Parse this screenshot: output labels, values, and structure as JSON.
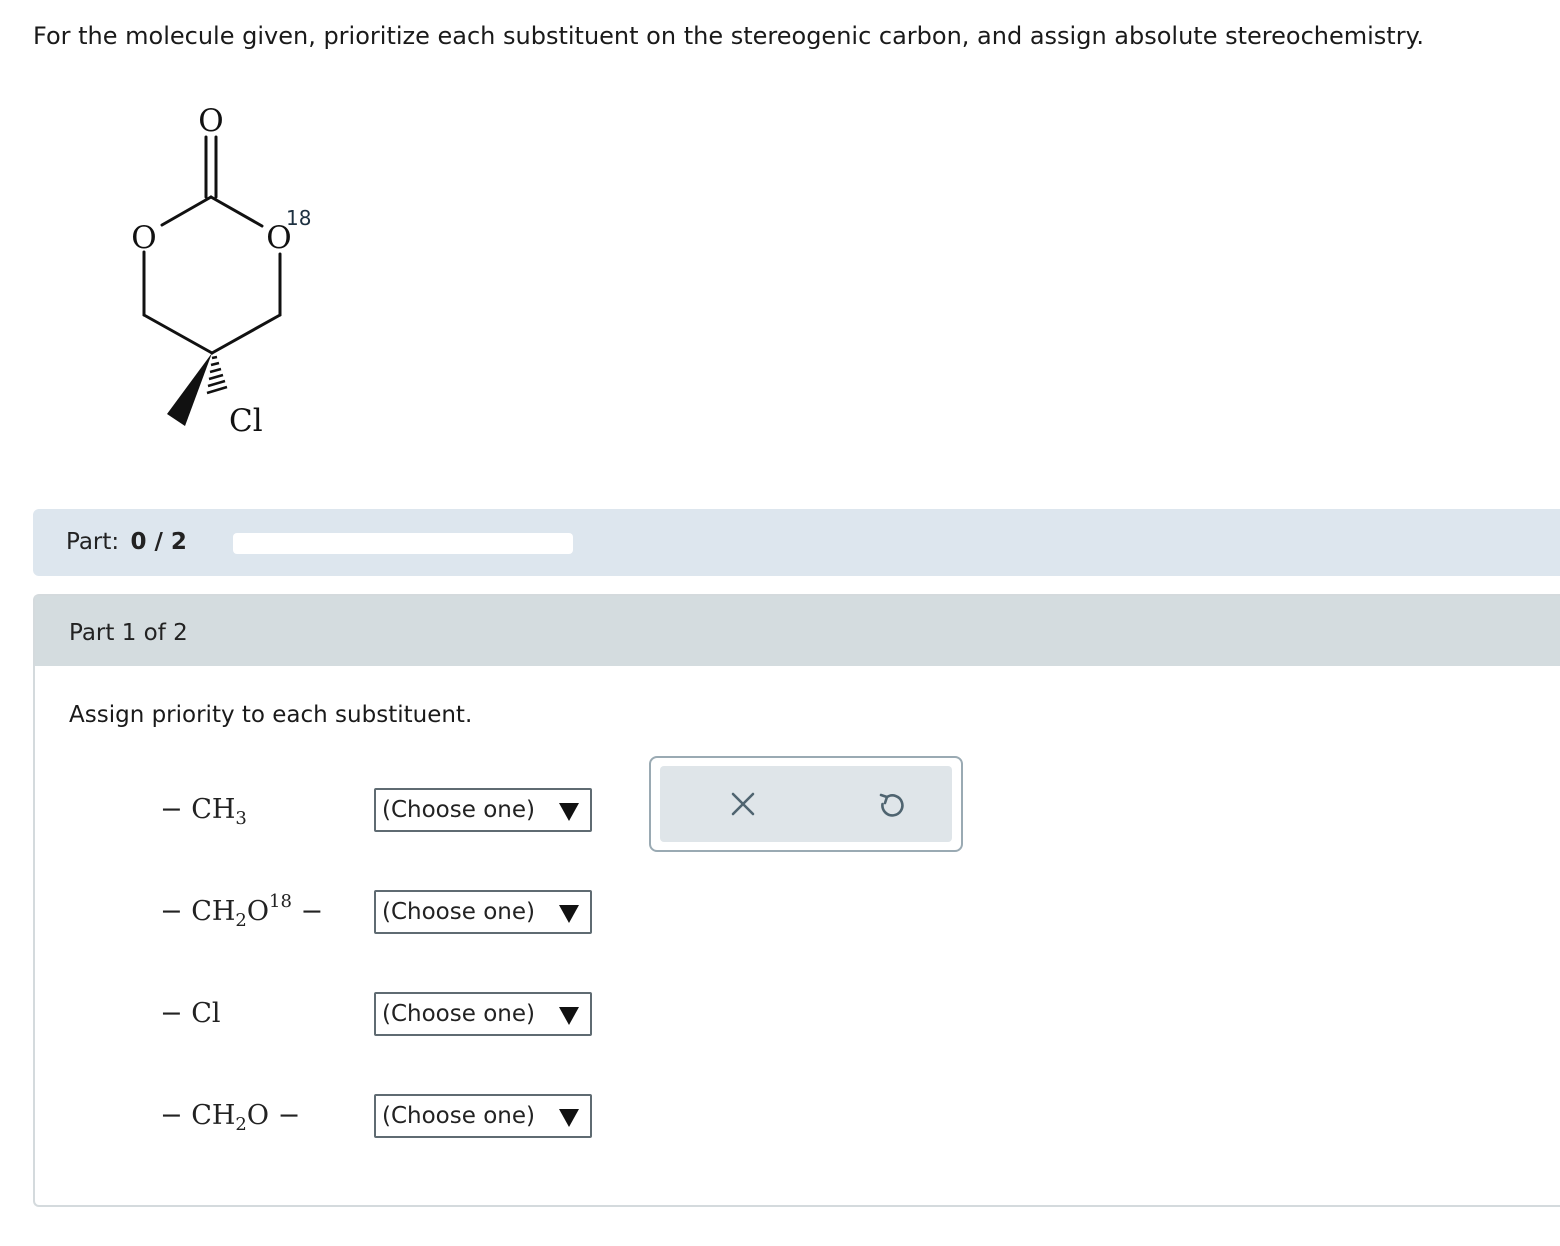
{
  "question": "For the molecule given, prioritize each substituent on the stereogenic carbon, and assign absolute stereochemistry.",
  "molecule": {
    "atoms": {
      "carbonyl_o": "O",
      "ring_o": "O",
      "ring_o18": "O",
      "isotope": "18",
      "chlorine": "Cl"
    }
  },
  "progress": {
    "label": "Part:",
    "score": "0 / 2",
    "completed": 0,
    "total": 2,
    "bar_color": "#2f7ec4"
  },
  "part": {
    "title": "Part 1 of 2",
    "instruction": "Assign priority to each substituent."
  },
  "substituents": [
    {
      "dash": "−",
      "main": " CH",
      "sub": "3",
      "after": "",
      "sup": "",
      "tail": "",
      "select": "(Choose one)"
    },
    {
      "dash": "−",
      "main": " CH",
      "sub": "2",
      "after": "O",
      "sup": "18",
      "tail": " −",
      "select": "(Choose one)"
    },
    {
      "dash": "−",
      "main": " Cl",
      "sub": "",
      "after": "",
      "sup": "",
      "tail": "",
      "select": "(Choose one)"
    },
    {
      "dash": "−",
      "main": " CH",
      "sub": "2",
      "after": "O",
      "sup": "",
      "tail": " −",
      "select": "(Choose one)"
    }
  ],
  "actions": {
    "clear_icon": "close-icon",
    "reset_icon": "undo-icon"
  }
}
